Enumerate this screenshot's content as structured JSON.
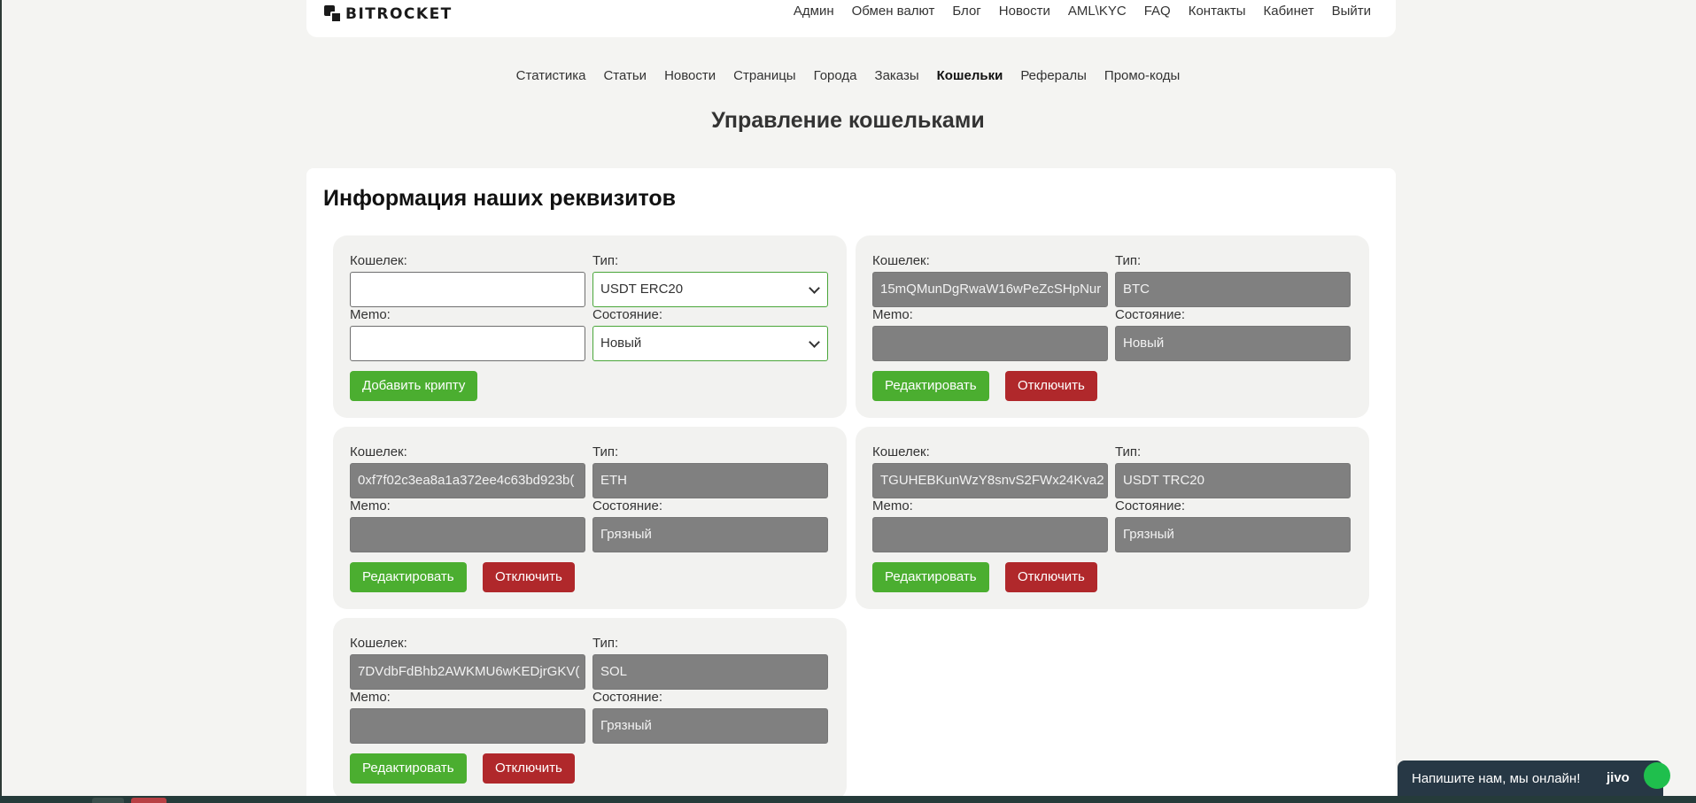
{
  "header": {
    "logo_text": "BITROCKET",
    "nav": [
      "Админ",
      "Обмен валют",
      "Блог",
      "Новости",
      "AML\\KYC",
      "FAQ",
      "Контакты",
      "Кабинет",
      "Выйти"
    ]
  },
  "sub_nav": {
    "items": [
      "Статистика",
      "Статьи",
      "Новости",
      "Страницы",
      "Города",
      "Заказы",
      "Кошельки",
      "Рефералы",
      "Промо-коды"
    ],
    "active": "Кошельки"
  },
  "page_title": "Управление кошельками",
  "panel_title": "Информация наших реквизитов",
  "labels": {
    "wallet": "Кошелек:",
    "type": "Тип:",
    "memo": "Memo:",
    "state": "Состояние:"
  },
  "new_wallet_form": {
    "wallet_value": "",
    "memo_value": "",
    "type_selected": "USDT ERC20",
    "state_selected": "Новый",
    "submit_label": "Добавить крипту"
  },
  "wallet_cards": [
    {
      "wallet": "15mQMunDgRwaW16wPeZcSHpNur",
      "type": "BTC",
      "memo": "",
      "state": "Новый"
    },
    {
      "wallet": "0xf7f02c3ea8a1a372ee4c63bd923b(",
      "type": "ETH",
      "memo": "",
      "state": "Грязный"
    },
    {
      "wallet": "TGUHEBKunWzY8snvS2FWx24Kva2",
      "type": "USDT TRC20",
      "memo": "",
      "state": "Грязный"
    },
    {
      "wallet": "7DVdbFdBhb2AWKMU6wKEDjrGKV(",
      "type": "SOL",
      "memo": "",
      "state": "Грязный"
    }
  ],
  "buttons": {
    "edit": "Редактировать",
    "disable": "Отключить"
  },
  "chat": {
    "text": "Напишите нам, мы онлайн!",
    "brand": "jivo"
  },
  "colors": {
    "accent_green": "#4bae30",
    "danger_red": "#b0282b",
    "disabled_field": "#808080",
    "chat_bg": "#273845"
  }
}
